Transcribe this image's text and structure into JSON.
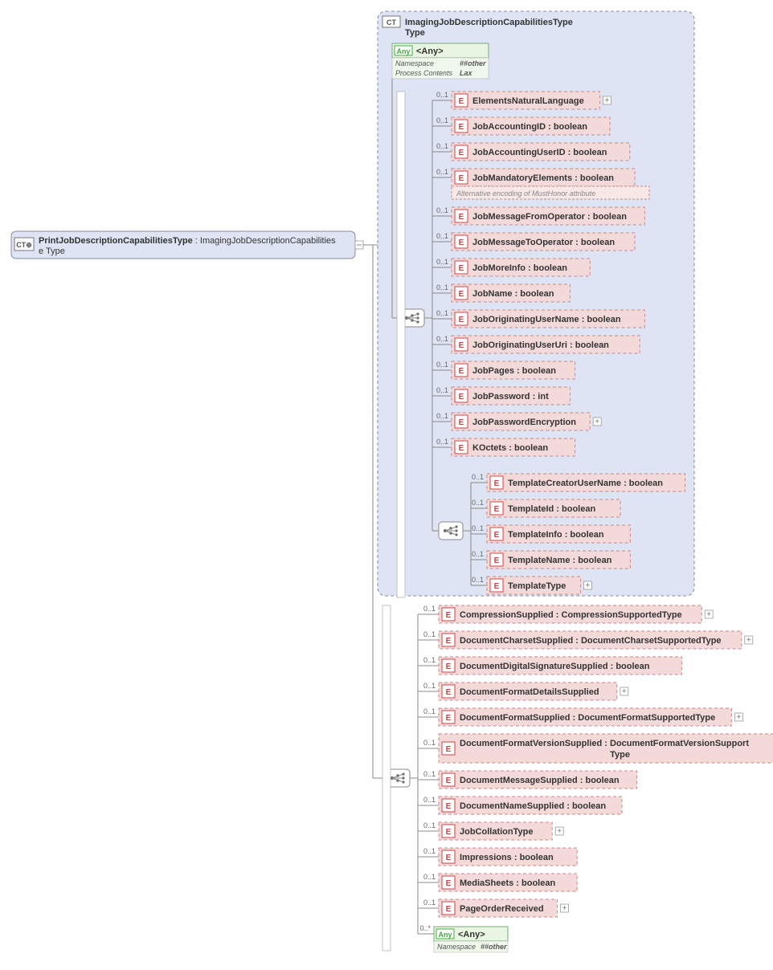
{
  "root": {
    "name": "PrintJobDescriptionCapabilitiesType",
    "baseType": "ImagingJobDescriptionCapabilitiesType",
    "sep": " : "
  },
  "complexType": {
    "label": "ImagingJobDescriptionCapabilitiesType",
    "sublabel": "Type"
  },
  "any": {
    "label": "<Any>",
    "namespaceLabel": "Namespace",
    "namespaceValue": "##other",
    "processLabel": "Process Contents",
    "processValue": "Lax"
  },
  "anyBottom": {
    "label": "<Any>",
    "namespaceLabel": "Namespace",
    "namespaceValue": "##other",
    "card": "0..*"
  },
  "card": "0..1",
  "innerElements": [
    {
      "name": "ElementsNaturalLanguage",
      "expand": true
    },
    {
      "name": "JobAccountingID",
      "type": "boolean"
    },
    {
      "name": "JobAccountingUserID",
      "type": "boolean"
    },
    {
      "name": "JobMandatoryElements",
      "type": "boolean",
      "note": "Alternative encoding of MustHonor attribute"
    },
    {
      "name": "JobMessageFromOperator",
      "type": "boolean"
    },
    {
      "name": "JobMessageToOperator",
      "type": "boolean"
    },
    {
      "name": "JobMoreInfo",
      "type": "boolean"
    },
    {
      "name": "JobName",
      "type": "boolean"
    },
    {
      "name": "JobOriginatingUserName",
      "type": "boolean"
    },
    {
      "name": "JobOriginatingUserUri",
      "type": "boolean"
    },
    {
      "name": "JobPages",
      "type": "boolean"
    },
    {
      "name": "JobPassword",
      "type": "int"
    },
    {
      "name": "JobPasswordEncryption",
      "expand": true
    },
    {
      "name": "KOctets",
      "type": "boolean",
      "sep": "  : "
    }
  ],
  "templateElements": [
    {
      "name": "TemplateCreatorUserName",
      "type": "boolean"
    },
    {
      "name": "TemplateId",
      "type": "boolean"
    },
    {
      "name": "TemplateInfo",
      "type": "boolean"
    },
    {
      "name": "TemplateName",
      "type": "boolean"
    },
    {
      "name": "TemplateType",
      "expand": true
    }
  ],
  "outerElements": [
    {
      "name": "CompressionSupplied",
      "type": "CompressionSupportedType",
      "expand": true
    },
    {
      "name": "DocumentCharsetSupplied",
      "type": "DocumentCharsetSupportedType",
      "expand": true
    },
    {
      "name": "DocumentDigitalSignatureSupplied",
      "type": "boolean"
    },
    {
      "name": "DocumentFormatDetailsSupplied",
      "expand": true
    },
    {
      "name": "DocumentFormatSupplied",
      "type": "DocumentFormatSupportedType",
      "expand": true
    },
    {
      "name": "DocumentFormatVersionSupplied",
      "type": "DocumentFormatVersionSupportedType",
      "expand": true,
      "twoLine": true
    },
    {
      "name": "DocumentMessageSupplied",
      "type": "boolean"
    },
    {
      "name": "DocumentNameSupplied",
      "type": "boolean"
    },
    {
      "name": "JobCollationType",
      "expand": true
    },
    {
      "name": "Impressions",
      "type": "boolean"
    },
    {
      "name": "MediaSheets",
      "type": "boolean"
    },
    {
      "name": "PageOrderReceived",
      "expand": true
    }
  ]
}
